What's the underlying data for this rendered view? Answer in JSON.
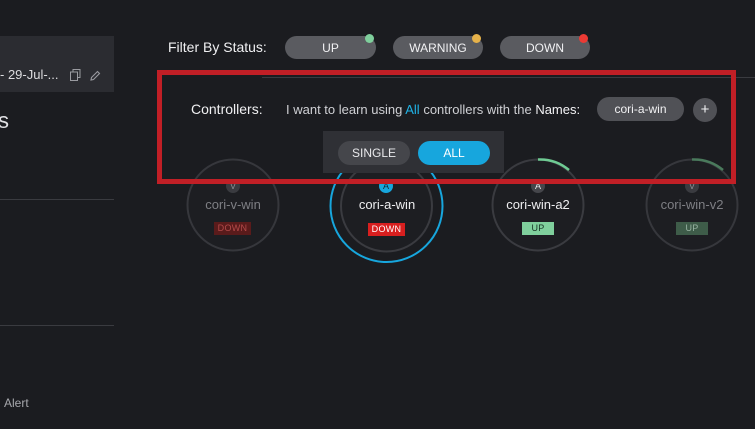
{
  "left": {
    "header_text": "- 29-Jul-...",
    "glyph": "s",
    "alert_text": "Alert"
  },
  "filter": {
    "label": "Filter By Status:",
    "statuses": [
      {
        "label": "UP",
        "dot_color": "#7fcf9c"
      },
      {
        "label": "WARNING",
        "dot_color": "#e6b24a"
      },
      {
        "label": "DOWN",
        "dot_color": "#ec3a34"
      }
    ]
  },
  "controllers_row": {
    "label": "Controllers:",
    "sentence_prefix": "I want to learn using ",
    "scope": "All",
    "sentence_middle": " controllers with the ",
    "names_label": "Names:",
    "name_chip": "cori-a-win",
    "add_symbol": "+"
  },
  "toggle": {
    "single_label": "SINGLE",
    "all_label": "ALL",
    "selected": "ALL"
  },
  "nodes": [
    {
      "letter": "V",
      "name": "cori-v-win",
      "status": "DOWN",
      "selected": false,
      "dimmed": true
    },
    {
      "letter": "A",
      "name": "cori-a-win",
      "status": "DOWN",
      "selected": true,
      "dimmed": false
    },
    {
      "letter": "A",
      "name": "cori-win-a2",
      "status": "UP",
      "selected": false,
      "dimmed": false
    },
    {
      "letter": "V",
      "name": "cori-win-v2",
      "status": "UP",
      "selected": false,
      "dimmed": true
    }
  ],
  "colors": {
    "accent": "#17a6dd",
    "highlight": "#c11f26",
    "down": "#d81f1f",
    "up": "#6fcb93",
    "background": "#1b1c20"
  }
}
